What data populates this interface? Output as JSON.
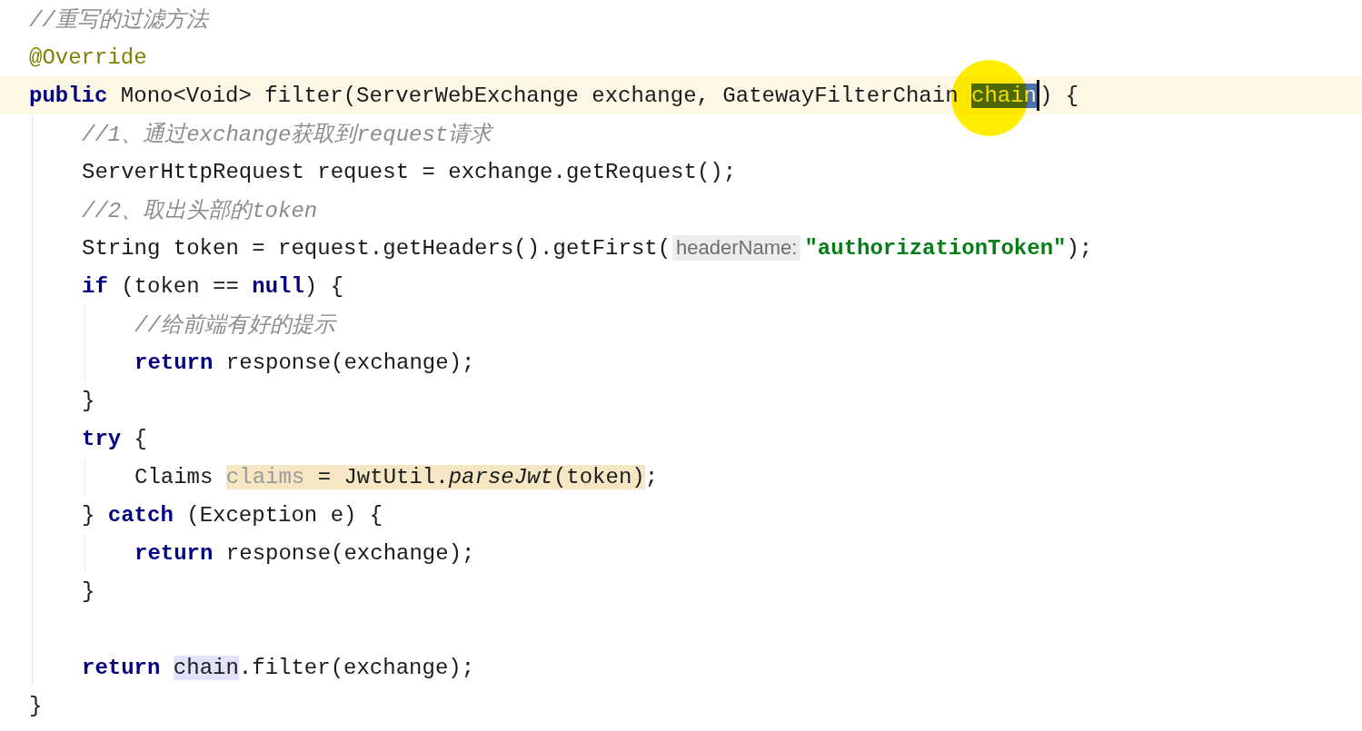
{
  "editor": {
    "lines": [
      {
        "kind": "code",
        "tokens": [
          {
            "text": "//重写的过滤方法",
            "kind": "comment"
          }
        ]
      },
      {
        "kind": "code",
        "tokens": [
          {
            "text": "@Override",
            "kind": "annotation"
          }
        ]
      },
      {
        "kind": "code",
        "current": true,
        "tokens": [
          {
            "text": "public",
            "kind": "keyword"
          },
          {
            "text": " Mono<Void> filter(ServerWebExchange exchange, GatewayFilterChain ",
            "kind": "plain"
          },
          {
            "text": "chain",
            "kind": "plain",
            "selected": true,
            "caret": true
          },
          {
            "text": ") {",
            "kind": "plain"
          }
        ],
        "children": [
          {
            "kind": "code",
            "tokens": [
              {
                "text": "//1、通过exchange获取到request请求",
                "kind": "comment"
              }
            ]
          },
          {
            "kind": "code",
            "tokens": [
              {
                "text": "ServerHttpRequest request = exchange.getRequest();",
                "kind": "plain"
              }
            ]
          },
          {
            "kind": "code",
            "tokens": [
              {
                "text": "//2、取出头部的token",
                "kind": "comment"
              }
            ]
          },
          {
            "kind": "code",
            "tokens": [
              {
                "text": "String token = request.getHeaders().getFirst(",
                "kind": "plain"
              },
              {
                "text": "headerName:",
                "kind": "hint"
              },
              {
                "text": "\"authorizationToken\"",
                "kind": "string"
              },
              {
                "text": ");",
                "kind": "plain"
              }
            ]
          },
          {
            "kind": "code",
            "tokens": [
              {
                "text": "if",
                "kind": "keyword"
              },
              {
                "text": " (token == ",
                "kind": "plain"
              },
              {
                "text": "null",
                "kind": "keyword"
              },
              {
                "text": ") {",
                "kind": "plain"
              }
            ],
            "children": [
              {
                "kind": "code",
                "tokens": [
                  {
                    "text": "//给前端有好的提示",
                    "kind": "comment"
                  }
                ]
              },
              {
                "kind": "code",
                "tokens": [
                  {
                    "text": "return",
                    "kind": "keyword"
                  },
                  {
                    "text": " response(exchange);",
                    "kind": "plain"
                  }
                ]
              }
            ]
          },
          {
            "kind": "code",
            "tokens": [
              {
                "text": "}",
                "kind": "plain"
              }
            ]
          },
          {
            "kind": "code",
            "tokens": [
              {
                "text": "try",
                "kind": "keyword"
              },
              {
                "text": " {",
                "kind": "plain"
              }
            ],
            "children": [
              {
                "kind": "code",
                "tokens": [
                  {
                    "text": "Claims ",
                    "kind": "plain"
                  },
                  {
                    "text": "claims",
                    "kind": "unused",
                    "highlighted": true
                  },
                  {
                    "text": " = JwtUtil.",
                    "kind": "plain",
                    "highlighted": true
                  },
                  {
                    "text": "parseJwt",
                    "kind": "static",
                    "highlighted": true
                  },
                  {
                    "text": "(token)",
                    "kind": "plain",
                    "highlighted": true
                  },
                  {
                    "text": ";",
                    "kind": "plain"
                  }
                ]
              }
            ]
          },
          {
            "kind": "code",
            "tokens": [
              {
                "text": "} ",
                "kind": "plain"
              },
              {
                "text": "catch",
                "kind": "keyword"
              },
              {
                "text": " (Exception e) {",
                "kind": "plain"
              }
            ],
            "children": [
              {
                "kind": "code",
                "tokens": [
                  {
                    "text": "return",
                    "kind": "keyword"
                  },
                  {
                    "text": " response(exchange);",
                    "kind": "plain"
                  }
                ]
              }
            ]
          },
          {
            "kind": "code",
            "tokens": [
              {
                "text": "}",
                "kind": "plain"
              }
            ]
          },
          {
            "kind": "blank"
          },
          {
            "kind": "code",
            "tokens": [
              {
                "text": "return ",
                "kind": "keyword"
              },
              {
                "text": "chain",
                "kind": "plain",
                "usage": true
              },
              {
                "text": ".filter(exchange);",
                "kind": "plain"
              }
            ]
          }
        ]
      },
      {
        "kind": "code",
        "tokens": [
          {
            "text": "}",
            "kind": "plain"
          }
        ]
      }
    ]
  }
}
